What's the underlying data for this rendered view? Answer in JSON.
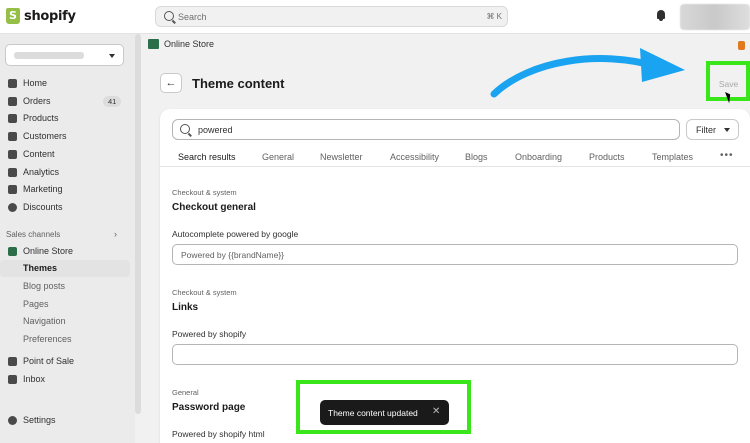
{
  "app": {
    "logo_text": "shopify"
  },
  "search": {
    "placeholder": "Search",
    "shortcut": "⌘ K"
  },
  "sidebar": {
    "items": [
      {
        "label": "Home",
        "icon": "home-icon"
      },
      {
        "label": "Orders",
        "icon": "orders-icon",
        "badge": "41"
      },
      {
        "label": "Products",
        "icon": "tag-icon"
      },
      {
        "label": "Customers",
        "icon": "person-icon"
      },
      {
        "label": "Content",
        "icon": "content-icon"
      },
      {
        "label": "Analytics",
        "icon": "analytics-icon"
      },
      {
        "label": "Marketing",
        "icon": "marketing-icon"
      },
      {
        "label": "Discounts",
        "icon": "discount-icon"
      }
    ],
    "sales_channels_label": "Sales channels",
    "online_store": "Online Store",
    "sub_items": [
      "Themes",
      "Blog posts",
      "Pages",
      "Navigation",
      "Preferences"
    ],
    "bottom_items": [
      {
        "label": "Point of Sale",
        "icon": "pos-icon"
      },
      {
        "label": "Inbox",
        "icon": "inbox-icon"
      }
    ],
    "settings": "Settings"
  },
  "breadcrumb": {
    "label": "Online Store"
  },
  "page": {
    "title": "Theme content",
    "save_label": "Save"
  },
  "filter": {
    "value": "powered",
    "button_label": "Filter"
  },
  "tabs": [
    "Search results",
    "General",
    "Newsletter",
    "Accessibility",
    "Blogs",
    "Onboarding",
    "Products",
    "Templates"
  ],
  "tabs_more": "•••",
  "groups": [
    {
      "category": "Checkout & system",
      "title": "Checkout general",
      "field_label": "Autocomplete powered by google",
      "field_value": "Powered by {{brandName}}"
    },
    {
      "category": "Checkout & system",
      "title": "Links",
      "field_label": "Powered by shopify",
      "field_value": ""
    },
    {
      "category": "General",
      "title": "Password page",
      "field_label": "Powered by shopify html",
      "field_value": ""
    }
  ],
  "toast": {
    "message": "Theme content updated",
    "close": "✕"
  },
  "colors": {
    "highlight": "#39e61a",
    "arrow": "#1aa3f0",
    "toast_bg": "#1a1a1a"
  }
}
